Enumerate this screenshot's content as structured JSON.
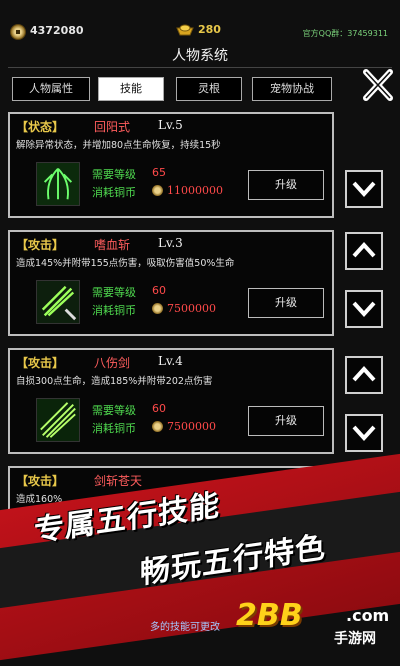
{
  "header": {
    "coins": "4372080",
    "ingots": "280",
    "qq_group": "官方QQ群：37459311",
    "title": "人物系统"
  },
  "tabs": [
    {
      "label": "人物属性",
      "active": false
    },
    {
      "label": "技能",
      "active": true
    },
    {
      "label": "灵根",
      "active": false
    },
    {
      "label": "宠物协战",
      "active": false
    }
  ],
  "labels": {
    "required_level": "需要等级",
    "cost_copper": "消耗铜币",
    "upgrade": "升级"
  },
  "skills": [
    {
      "tag": "【状态】",
      "name": "回阳式",
      "level": "Lv.5",
      "desc": "解除异常状态，并增加80点生命恢复，持续15秒",
      "req_level": "65",
      "cost": "11000000",
      "arrows": [
        "down"
      ],
      "icon_color": "#3fbf3f"
    },
    {
      "tag": "【攻击】",
      "name": "嗜血斩",
      "level": "Lv.3",
      "desc": "造成145%并附带155点伤害，吸取伤害值50%生命",
      "req_level": "60",
      "cost": "7500000",
      "arrows": [
        "up",
        "down"
      ],
      "icon_color": "#3fbf3f"
    },
    {
      "tag": "【攻击】",
      "name": "八伤剑",
      "level": "Lv.4",
      "desc": "自损300点生命，造成185%并附带202点伤害",
      "req_level": "60",
      "cost": "7500000",
      "arrows": [
        "up",
        "down"
      ],
      "icon_color": "#3fbf3f"
    },
    {
      "tag": "【攻击】",
      "name": "剑斩苍天",
      "level": "",
      "desc": "造成160%",
      "req_level": "",
      "cost": "",
      "arrows": [],
      "icon_color": "#3fbf3f"
    }
  ],
  "promo": {
    "line1": "专属五行技能",
    "line2": "畅玩五行特色",
    "hint": "多的技能可更改",
    "logo_main": "2BB",
    "logo_dot": ".com",
    "logo_sub": "手游网"
  },
  "colors": {
    "accent_red": "#c1121a",
    "tag_yellow": "#e8c84a",
    "label_green": "#4fd94f",
    "value_red": "#ff4a4a"
  }
}
